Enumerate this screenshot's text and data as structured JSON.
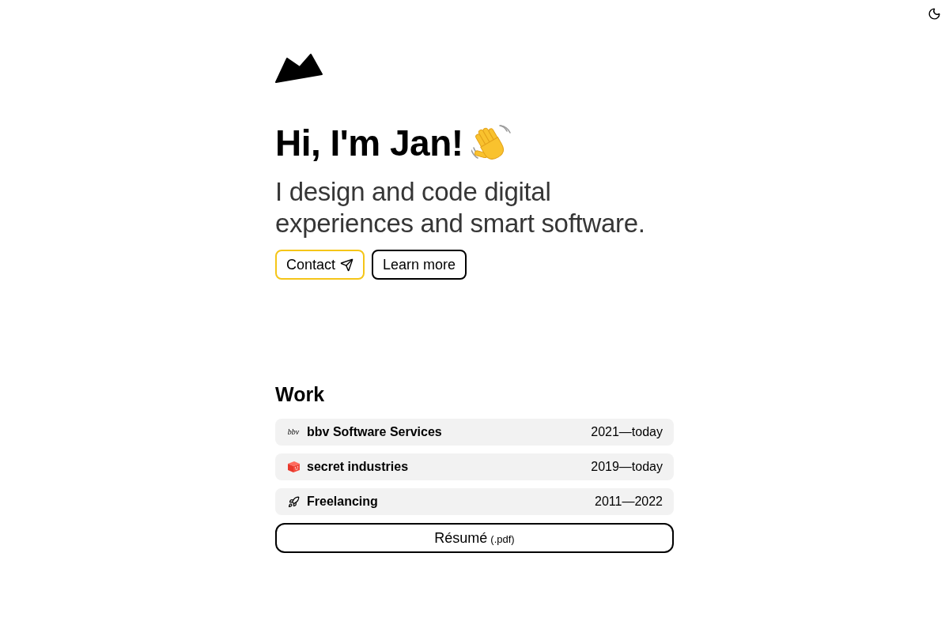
{
  "hero": {
    "title": "Hi, I'm Jan!",
    "subtitle": "I design and code digital experiences and smart software.",
    "buttons": [
      {
        "label": "Contact",
        "kind": "primary"
      },
      {
        "label": "Learn more",
        "kind": "secondary"
      }
    ]
  },
  "work": {
    "heading": "Work",
    "jobs": [
      {
        "kind": "text-logo",
        "logo_text": "bbv",
        "company": "bbv Software Services",
        "period": "2021—today"
      },
      {
        "kind": "box",
        "company": "secret industries",
        "period": "2019—today"
      },
      {
        "kind": "rocket",
        "company": "Freelancing",
        "period": "2011—2022"
      }
    ],
    "resume": {
      "label": "Résumé",
      "suffix": "(.pdf)"
    }
  }
}
